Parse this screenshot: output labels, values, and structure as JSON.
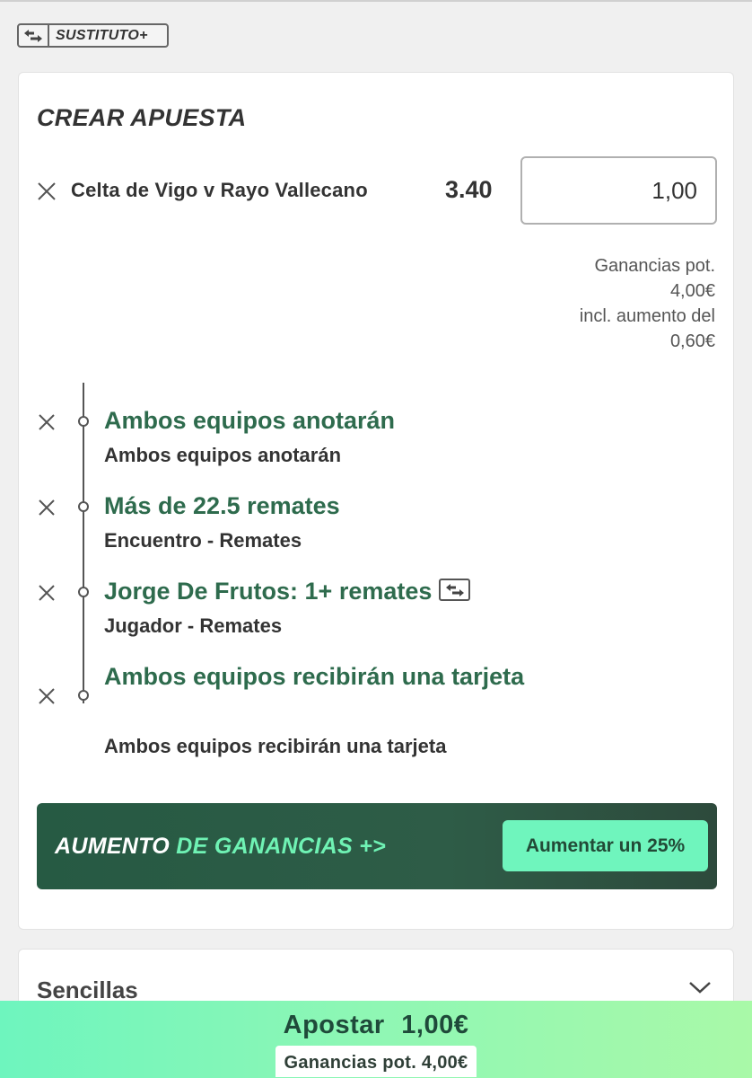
{
  "badge": {
    "label": "SUSTITUTO+"
  },
  "card": {
    "title": "CREAR APUESTA",
    "match": {
      "name": "Celta de Vigo v Rayo Vallecano",
      "odds": "3.40",
      "stake": "1,00"
    },
    "potential": {
      "label": "Ganancias pot.",
      "amount": "4,00€",
      "boost_label": "incl. aumento del",
      "boost_amount": "0,60€"
    },
    "selections": [
      {
        "title": "Ambos equipos anotarán",
        "subtitle": "Ambos equipos anotarán"
      },
      {
        "title": "Más de 22.5 remates",
        "subtitle": "Encuentro - Remates"
      },
      {
        "title": "Jorge De Frutos: 1+ remates",
        "subtitle": "Jugador - Remates"
      },
      {
        "title": "Ambos equipos recibirán una tarjeta",
        "subtitle": "Ambos equipos recibirán una tarjeta"
      }
    ],
    "boost": {
      "word1": "AUMENTO",
      "word2": "DE GANANCIAS",
      "arrow": "+>",
      "button": "Aumentar un 25%"
    }
  },
  "singles": {
    "title": "Sencillas"
  },
  "bet_bar": {
    "button": "Apostar 1,00€",
    "potential": "Ganancias pot. 4,00€"
  },
  "colors": {
    "selection_green": "#2e6b4d",
    "boost_bg": "#265a43",
    "accent_mint": "#6ff5bd"
  },
  "icons": {
    "remove": "close-icon",
    "swap": "swap-icon",
    "expand": "chevron-down-icon"
  }
}
